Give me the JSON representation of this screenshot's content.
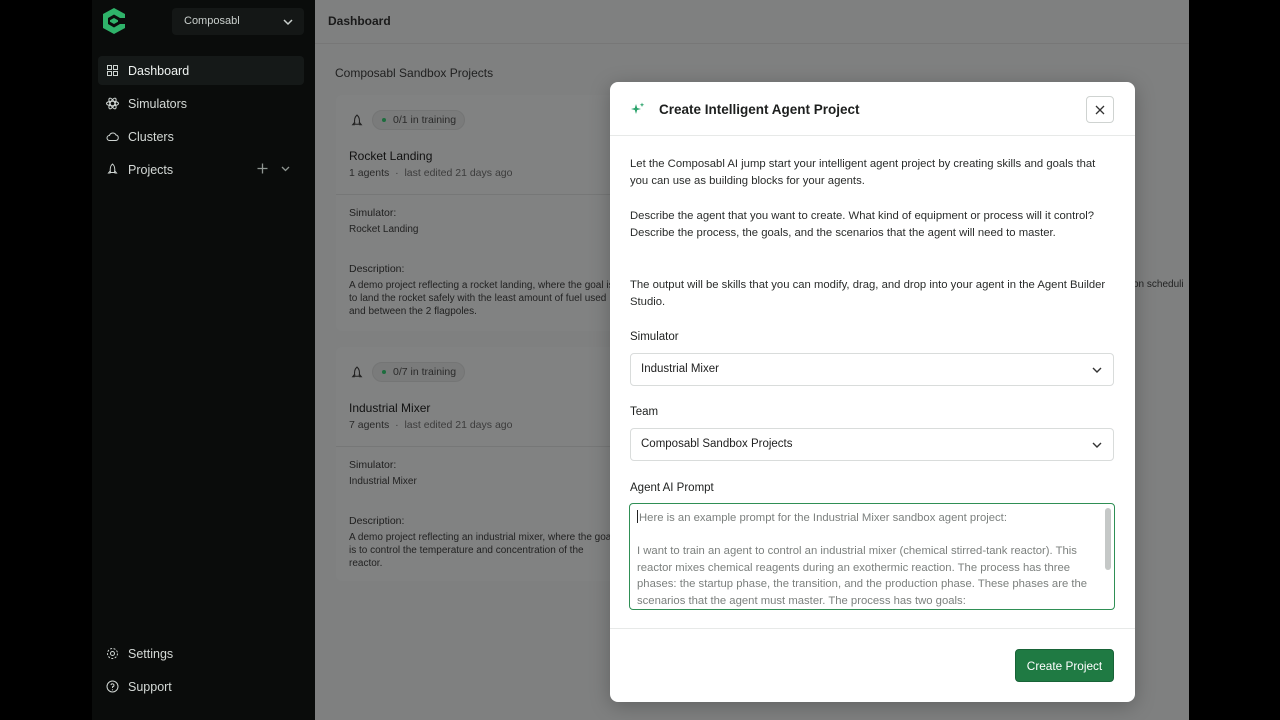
{
  "sidebar": {
    "org_selector": "Composabl",
    "items": [
      {
        "label": "Dashboard",
        "icon": "grid-icon"
      },
      {
        "label": "Simulators",
        "icon": "atom-icon"
      },
      {
        "label": "Clusters",
        "icon": "cloud-icon"
      },
      {
        "label": "Projects",
        "icon": "rocket-icon"
      }
    ],
    "bottom": [
      {
        "label": "Settings",
        "icon": "gear-icon"
      },
      {
        "label": "Support",
        "icon": "help-icon"
      }
    ]
  },
  "header": {
    "title": "Dashboard"
  },
  "main": {
    "section_title": "Composabl Sandbox Projects",
    "cards": [
      {
        "status": "0/1 in training",
        "name": "Rocket Landing",
        "agents": "1 agents",
        "edited": "last edited 21 days ago",
        "simulator_label": "Simulator:",
        "simulator": "Rocket Landing",
        "description_label": "Description:",
        "description": "A demo project reflecting a rocket landing, where the goal is to land the rocket safely with the least amount of fuel used and between the 2 flagpoles."
      },
      {
        "status": "0/7 in training",
        "name": "Industrial Mixer",
        "agents": "7 agents",
        "edited": "last edited 21 days ago",
        "simulator_label": "Simulator:",
        "simulator": "Industrial Mixer",
        "description_label": "Description:",
        "description": "A demo project reflecting an industrial mixer, where the goal is to control the temperature and concentration of the reactor."
      }
    ],
    "partial_text": "on scheduli"
  },
  "modal": {
    "title": "Create Intelligent Agent Project",
    "paragraphs": [
      "Let the Composabl AI jump start your intelligent agent project by creating skills and goals that you can use as building blocks for your agents.",
      "Describe the agent that you want to create. What kind of equipment or process will it control? Describe the process, the goals, and the scenarios that the agent will need to master.",
      "The output will be skills that you can modify, drag, and drop into your agent in the Agent Builder Studio."
    ],
    "simulator_label": "Simulator",
    "simulator_value": "Industrial Mixer",
    "team_label": "Team",
    "team_value": "Composabl Sandbox Projects",
    "prompt_label": "Agent AI Prompt",
    "prompt_line1": "Here is an example prompt for the Industrial Mixer sandbox agent project:",
    "prompt_line2": "I want to train an agent to control an industrial mixer (chemical stirred-tank reactor). This reactor mixes chemical reagents during an exothermic reaction. The process has three phases:  the startup phase, the transition, and the production phase. These phases are the scenarios that the agent must master. The process has two goals:",
    "create_label": "Create Project"
  }
}
